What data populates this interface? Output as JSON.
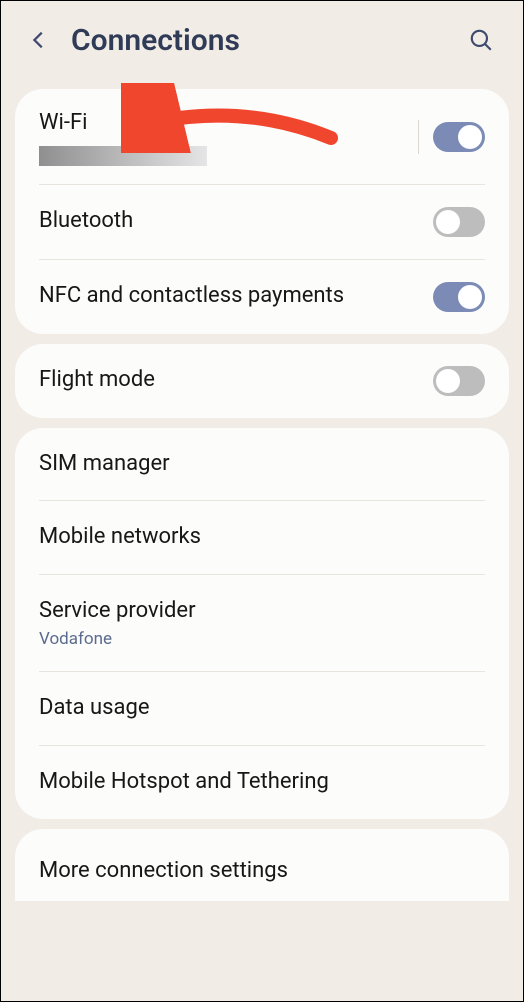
{
  "header": {
    "title": "Connections"
  },
  "groups": [
    {
      "items": [
        {
          "label": "Wi-Fi",
          "toggle": "on",
          "hasVDiv": true,
          "redacted": true
        },
        {
          "label": "Bluetooth",
          "toggle": "off",
          "hasVDiv": false
        },
        {
          "label": "NFC and contactless payments",
          "toggle": "on",
          "hasVDiv": false
        }
      ]
    },
    {
      "items": [
        {
          "label": "Flight mode",
          "toggle": "off",
          "hasVDiv": false
        }
      ]
    },
    {
      "items": [
        {
          "label": "SIM manager"
        },
        {
          "label": "Mobile networks"
        },
        {
          "label": "Service provider",
          "sub": "Vodafone"
        },
        {
          "label": "Data usage"
        },
        {
          "label": "Mobile Hotspot and Tethering"
        }
      ]
    }
  ],
  "partial": {
    "label": "More connection settings"
  },
  "annotation": {
    "arrow_color": "#f1462e"
  }
}
